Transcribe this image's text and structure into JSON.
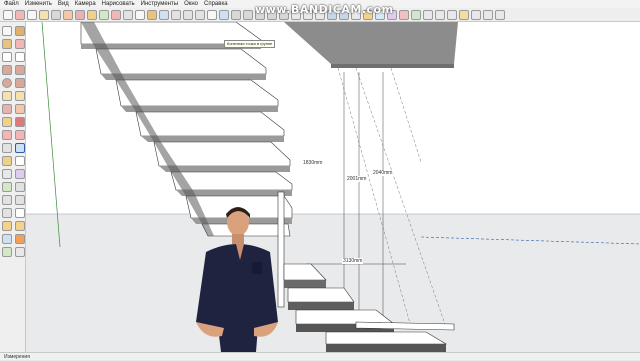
{
  "menu": {
    "items": [
      "Файл",
      "Изменить",
      "Вид",
      "Камера",
      "Нарисовать",
      "Инструменты",
      "Окно",
      "Справка"
    ]
  },
  "watermark": "www.BANDICAM.com",
  "tooltip": "Конечная точка в группе",
  "dimensions": {
    "d1": "1830mm",
    "d2": "2001mm",
    "d3": "2040mm",
    "d4": "3130mm"
  },
  "status": {
    "label": "Измерения"
  },
  "icons": {
    "toolbar": [
      "select-icon",
      "eraser-icon",
      "line-icon",
      "arc-icon",
      "rectangle-icon",
      "push-pull-icon",
      "move-icon",
      "rotate-icon",
      "scale-icon",
      "offset-icon",
      "tape-measure-icon",
      "text-icon",
      "paint-bucket-icon",
      "orbit-icon",
      "pan-icon",
      "zoom-icon",
      "zoom-extents-icon"
    ],
    "sidebar": [
      "select-icon",
      "component-icon",
      "paint-bucket-icon",
      "eraser-icon",
      "line-icon",
      "freehand-icon",
      "rectangle-icon",
      "rotated-rectangle-icon",
      "circle-icon",
      "polygon-icon",
      "arc-icon",
      "pie-icon",
      "move-icon",
      "push-pull-icon",
      "rotate-icon",
      "follow-me-icon",
      "scale-icon",
      "offset-icon",
      "tape-measure-icon",
      "dimension-icon",
      "protractor-icon",
      "text-icon",
      "axes-icon",
      "3d-text-icon",
      "orbit-icon",
      "pan-icon",
      "zoom-icon",
      "zoom-window-icon",
      "zoom-extents-icon",
      "previous-view-icon",
      "position-camera-icon",
      "walk-icon",
      "look-around-icon",
      "section-plane-icon",
      "sandbox-icon",
      "dynamic-icon"
    ]
  },
  "colors": {
    "accent_red": "#c0392b",
    "accent_green": "#3a8a3a",
    "accent_blue": "#2b5fa8",
    "accent_yellow": "#d9b021",
    "stair_gray": "#8c8c8c",
    "shirt_navy": "#1f2340"
  }
}
